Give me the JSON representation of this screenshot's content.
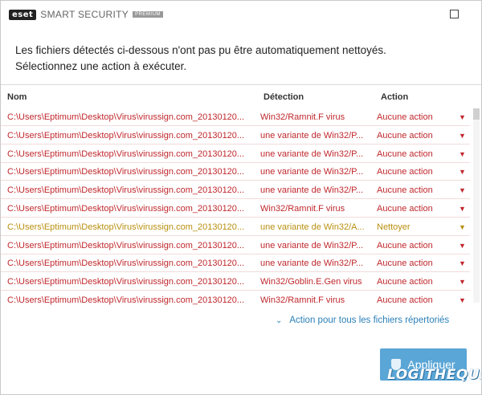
{
  "app": {
    "brand": "eset",
    "product": "SMART SECURITY",
    "edition": "PREMIUM"
  },
  "message": {
    "line1": "Les fichiers détectés ci-dessous n'ont pas pu être automatiquement nettoyés.",
    "line2": "Sélectionnez une action à exécuter."
  },
  "table": {
    "columns": {
      "name": "Nom",
      "detection": "Détection",
      "action": "Action"
    },
    "rows": [
      {
        "path": "C:\\Users\\Eptimum\\Desktop\\Virus\\virussign.com_20130120...",
        "detection": "Win32/Ramnit.F virus",
        "action": "Aucune action",
        "status": "error"
      },
      {
        "path": "C:\\Users\\Eptimum\\Desktop\\Virus\\virussign.com_20130120...",
        "detection": "une variante de Win32/P...",
        "action": "Aucune action",
        "status": "error"
      },
      {
        "path": "C:\\Users\\Eptimum\\Desktop\\Virus\\virussign.com_20130120...",
        "detection": "une variante de Win32/P...",
        "action": "Aucune action",
        "status": "error"
      },
      {
        "path": "C:\\Users\\Eptimum\\Desktop\\Virus\\virussign.com_20130120...",
        "detection": "une variante de Win32/P...",
        "action": "Aucune action",
        "status": "error"
      },
      {
        "path": "C:\\Users\\Eptimum\\Desktop\\Virus\\virussign.com_20130120...",
        "detection": "une variante de Win32/P...",
        "action": "Aucune action",
        "status": "error"
      },
      {
        "path": "C:\\Users\\Eptimum\\Desktop\\Virus\\virussign.com_20130120...",
        "detection": "Win32/Ramnit.F virus",
        "action": "Aucune action",
        "status": "error"
      },
      {
        "path": "C:\\Users\\Eptimum\\Desktop\\Virus\\virussign.com_20130120...",
        "detection": "une variante de Win32/A...",
        "action": "Nettoyer",
        "status": "warn"
      },
      {
        "path": "C:\\Users\\Eptimum\\Desktop\\Virus\\virussign.com_20130120...",
        "detection": "une variante de Win32/P...",
        "action": "Aucune action",
        "status": "error"
      },
      {
        "path": "C:\\Users\\Eptimum\\Desktop\\Virus\\virussign.com_20130120...",
        "detection": "une variante de Win32/P...",
        "action": "Aucune action",
        "status": "error"
      },
      {
        "path": "C:\\Users\\Eptimum\\Desktop\\Virus\\virussign.com_20130120...",
        "detection": "Win32/Goblin.E.Gen virus",
        "action": "Aucune action",
        "status": "error"
      },
      {
        "path": "C:\\Users\\Eptimum\\Desktop\\Virus\\virussign.com_20130120...",
        "detection": "Win32/Ramnit.F virus",
        "action": "Aucune action",
        "status": "error"
      }
    ]
  },
  "footer": {
    "all_files_label": "Action pour tous les fichiers répertoriés",
    "apply_label": "Appliquer"
  },
  "watermark": "LOGITHEQUE",
  "colors": {
    "error": "#c0282d",
    "warn": "#b9900f",
    "accent": "#2a7fb8",
    "apply": "#5aa6d6"
  }
}
